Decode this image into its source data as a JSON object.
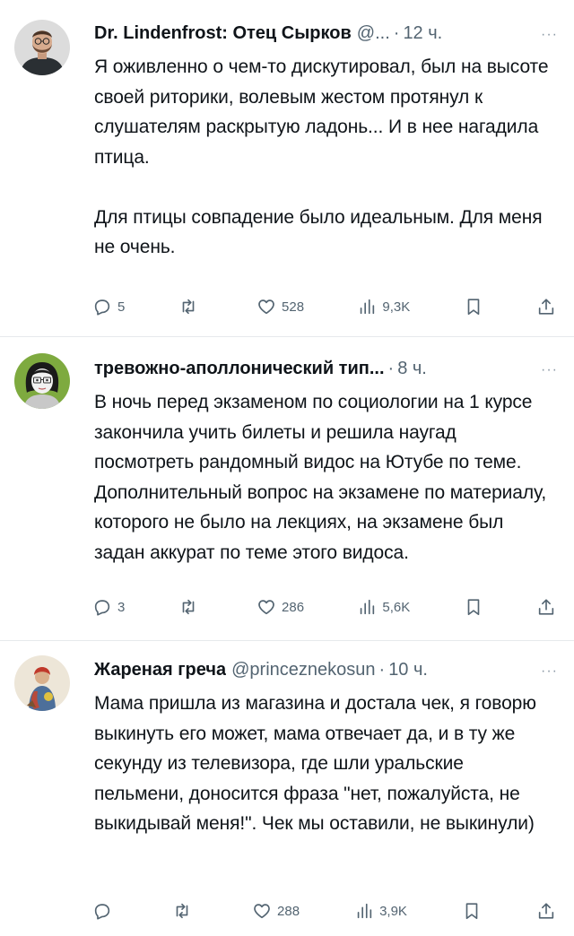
{
  "tweets": [
    {
      "name": "Dr. Lindenfrost: Отец Сырков",
      "handle": "@...",
      "time": "12 ч.",
      "text": "Я оживленно о чем-то дискутировал, был на высоте своей риторики, волевым жестом протянул к слушателям раскрытую ладонь... И в нее нагадила птица.\n\nДля птицы совпадение было идеальным. Для меня не очень.",
      "replies": "5",
      "retweets": "",
      "likes": "528",
      "views": "9,3K",
      "avatar_icon": "bearded-man-avatar"
    },
    {
      "name": "тревожно-аполлонический тип...",
      "handle": "",
      "time": "8 ч.",
      "text": "В ночь перед экзаменом по социологии на 1 курсе закончила учить билеты и решила наугад посмотреть рандомный видос на Ютубе по теме. Дополнительный вопрос на экзамене по материалу, которого не было на лекциях, на экзамене был задан аккурат по теме этого видоса.",
      "replies": "3",
      "retweets": "",
      "likes": "286",
      "views": "5,6K",
      "avatar_icon": "cartoon-woman-avatar"
    },
    {
      "name": "Жареная греча",
      "handle": "@princeznekosun",
      "time": "10 ч.",
      "text": "Мама пришла из магазина и достала чек, я говорю выкинуть его может, мама отвечает да, и в ту же секунду из телевизора, где шли уральские пельмени, доносится фраза \"нет, пожалуйста, не выкидывай меня!\". Чек мы оставили, не выкинули)",
      "replies": "",
      "retweets": "",
      "likes": "288",
      "views": "3,9K",
      "avatar_icon": "painted-figure-avatar"
    }
  ],
  "common": {
    "dot": "·",
    "more": "···"
  }
}
